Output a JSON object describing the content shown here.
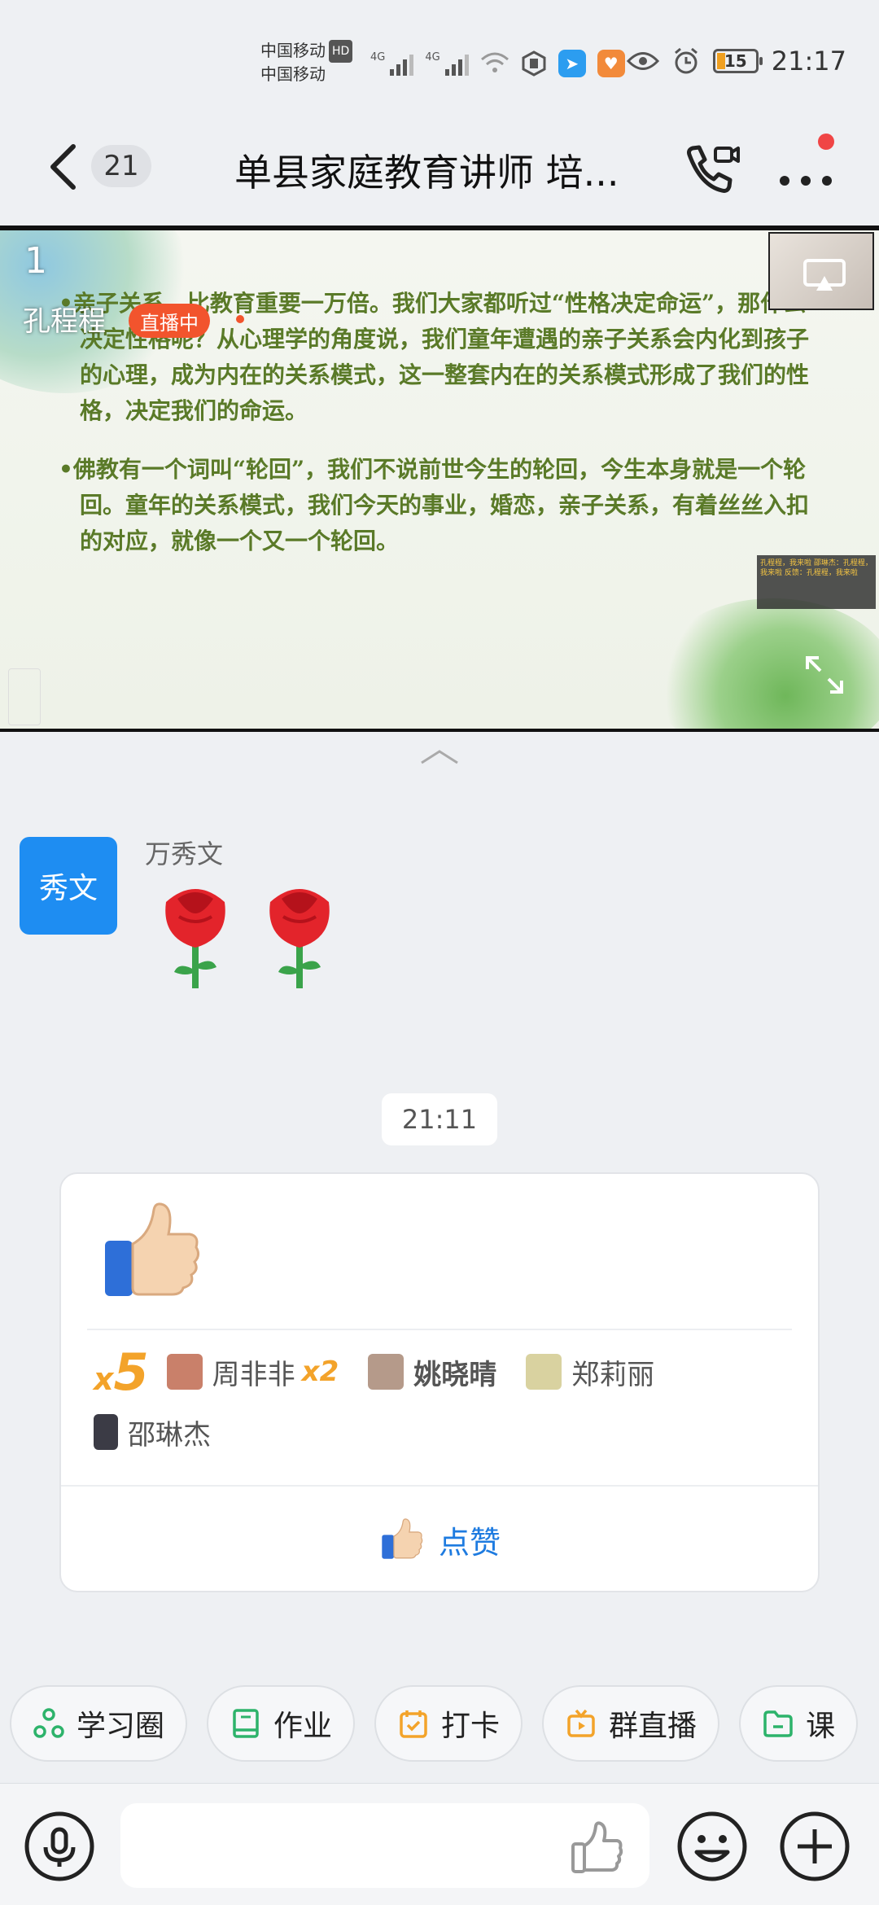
{
  "status_bar": {
    "carrier_1": "中国移动",
    "carrier_1_badge": "HD",
    "carrier_2": "中国移动",
    "signal_1_label": "4G",
    "signal_2_label": "4G",
    "battery": "15",
    "time": "21:17"
  },
  "header": {
    "unread_count": "21",
    "title": "单县家庭教育讲师 培..."
  },
  "live": {
    "index": "1",
    "host_name": "孔程程",
    "badge": "直播中",
    "slide_paragraphs": [
      "•亲子关系，比教育重要一万倍。我们大家都听过“性格决定命运”，那什么决定性格呢？从心理学的角度说，我们童年遭遇的亲子关系会内化到孩子的心理，成为内在的关系模式，这一整套内在的关系模式形成了我们的性格，决定我们的命运。",
      "•佛教有一个词叫“轮回”，我们不说前世今生的轮回，今生本身就是一个轮回。童年的关系模式，我们今天的事业，婚恋，亲子关系，有着丝丝入扣的对应，就像一个又一个轮回。"
    ],
    "overlay_chat": "孔程程，我来啦 邵琳杰：孔程程，我来啦 反馈：孔程程，我来啦"
  },
  "message_1": {
    "avatar_text": "秀文",
    "sender": "万秀文",
    "content": "🌹🌹"
  },
  "timestamp": "21:11",
  "like_card": {
    "emoji": "👍",
    "total_multiplier_x": "x",
    "total_multiplier_n": "5",
    "likers": [
      {
        "name": "周非非",
        "count": "x2",
        "color": "#c9806a"
      },
      {
        "name": "姚晓晴",
        "count": "",
        "color": "#b59a8a"
      },
      {
        "name": "郑莉丽",
        "count": "",
        "color": "#d9d2a0"
      },
      {
        "name": "邵琳杰",
        "count": "",
        "color": "#3b3b45"
      }
    ],
    "like_button_label": "点赞"
  },
  "quick_actions": [
    {
      "label": "学习圈",
      "icon": "circle-network-icon",
      "color": "#2db36b"
    },
    {
      "label": "作业",
      "icon": "book-icon",
      "color": "#2db36b"
    },
    {
      "label": "打卡",
      "icon": "calendar-check-icon",
      "color": "#f3a32a"
    },
    {
      "label": "群直播",
      "icon": "tv-icon",
      "color": "#f3a32a"
    },
    {
      "label": "课",
      "icon": "folder-icon",
      "color": "#2db36b"
    }
  ],
  "input": {
    "placeholder": ""
  },
  "colors": {
    "accent_blue": "#1e7be0",
    "avatar_blue": "#1e8df2",
    "like_orange": "#f3a32a",
    "live_red": "#f2542d",
    "background": "#eef0f3"
  }
}
